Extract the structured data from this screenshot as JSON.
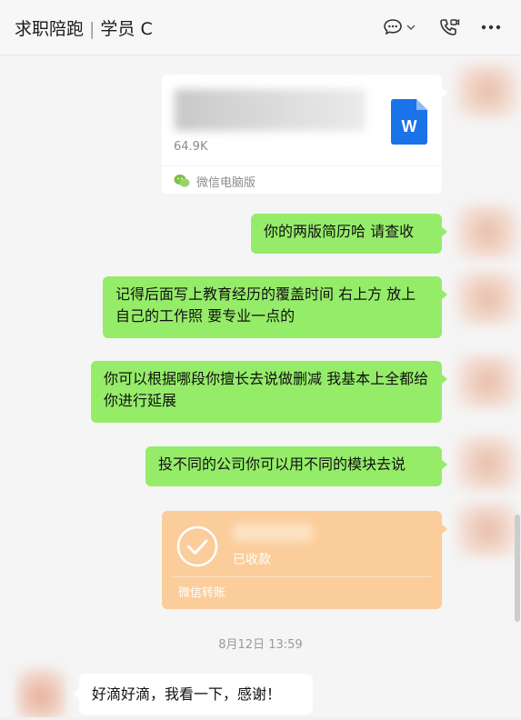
{
  "header": {
    "title": "求职陪跑",
    "separator": "|",
    "contact": "学员 C",
    "icons": [
      "chat-bubble-icon",
      "chevron-down-icon",
      "phone-video-icon",
      "more-icon"
    ]
  },
  "messages": [
    {
      "type": "file",
      "size": "64.9K",
      "source": "微信电脑版",
      "icon": "word-doc-icon"
    },
    {
      "type": "text",
      "text": "你的两版简历哈 请查收"
    },
    {
      "type": "text",
      "text": "记得后面写上教育经历的覆盖时间 右上方 放上自己的工作照 要专业一点的"
    },
    {
      "type": "text",
      "text": "你可以根据哪段你擅长去说做删减 我基本上全都给你进行延展"
    },
    {
      "type": "text",
      "text": "投不同的公司你可以用不同的模块去说"
    },
    {
      "type": "transfer",
      "status": "已收款",
      "label": "微信转账"
    }
  ],
  "timestamp": "8月12日 13:59",
  "reply": {
    "text": "好滴好滴，我看一下，感谢！"
  },
  "colors": {
    "sent_bubble": "#95ec69",
    "transfer": "#fbcd9a",
    "background": "#f5f5f5",
    "word_blue": "#1a73e8"
  }
}
